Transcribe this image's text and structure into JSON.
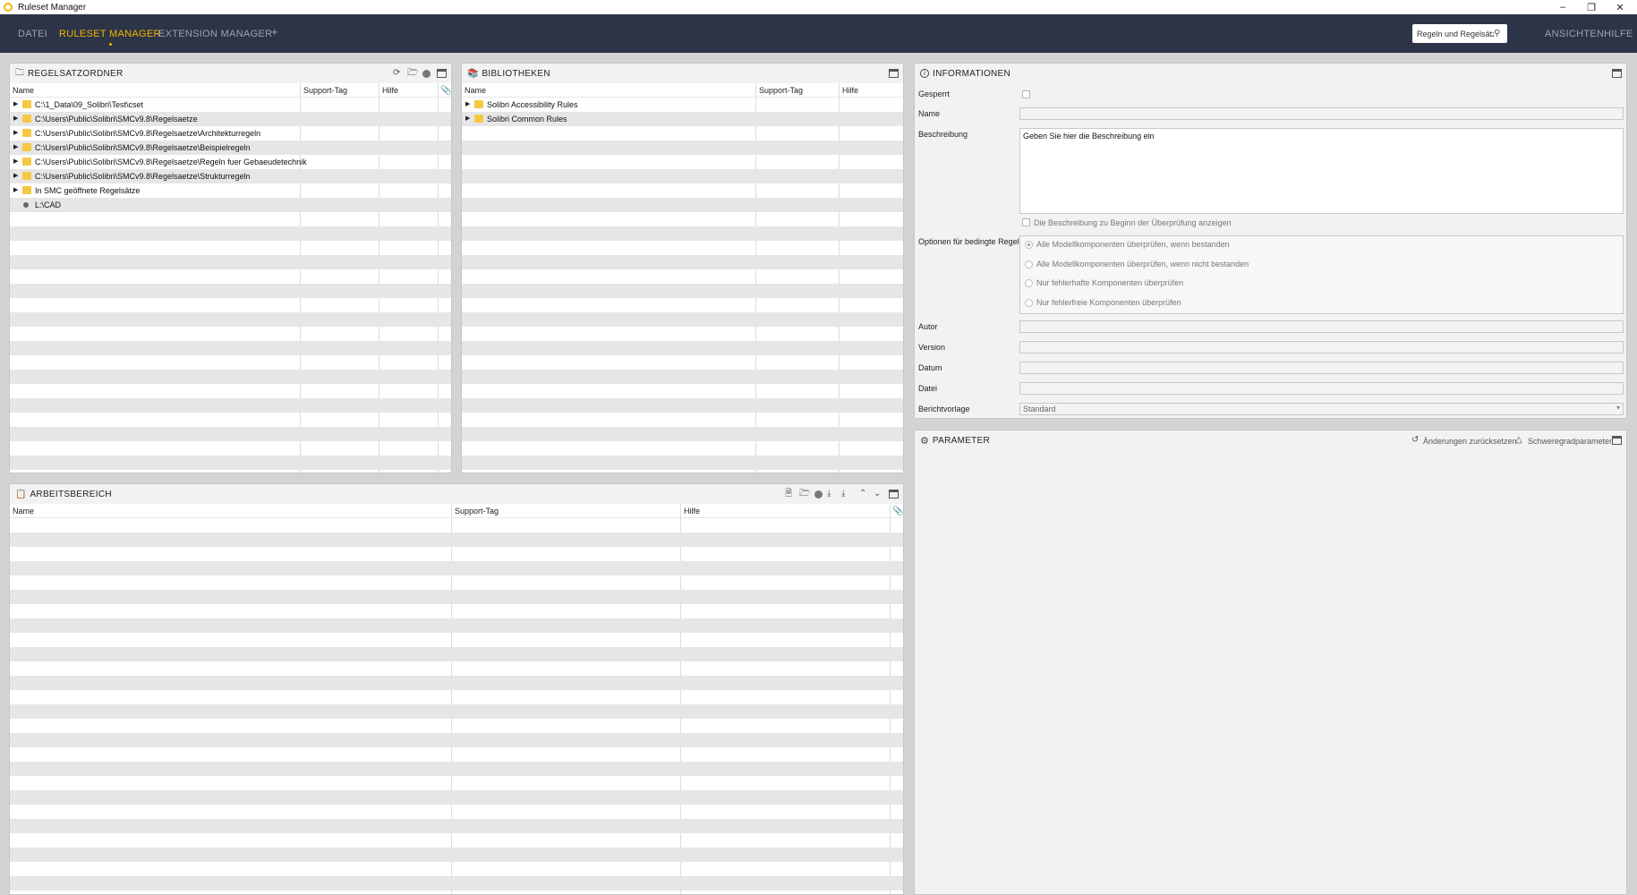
{
  "window": {
    "title": "Ruleset Manager",
    "minimize": "–",
    "restore": "❐",
    "close": "✕"
  },
  "menu": {
    "items": [
      "DATEI",
      "RULESET MANAGER",
      "EXTENSION MANAGER",
      "+"
    ],
    "right_items": [
      "ANSICHTEN",
      "HILFE"
    ],
    "search_placeholder": "Regeln und Regelsätze suchen"
  },
  "regelsatzordner": {
    "title": "REGELSATZORDNER",
    "columns": [
      "Name",
      "Support-Tag",
      "Hilfe"
    ],
    "rows": [
      {
        "label": "C:\\1_Data\\09_Solibri\\Test\\cset",
        "kind": "folder"
      },
      {
        "label": "C:\\Users\\Public\\Solibri\\SMCv9.8\\Regelsaetze",
        "kind": "folder"
      },
      {
        "label": "C:\\Users\\Public\\Solibri\\SMCv9.8\\Regelsaetze\\Architekturregeln",
        "kind": "folder"
      },
      {
        "label": "C:\\Users\\Public\\Solibri\\SMCv9.8\\Regelsaetze\\Beispielregeln",
        "kind": "folder"
      },
      {
        "label": "C:\\Users\\Public\\Solibri\\SMCv9.8\\Regelsaetze\\Regeln fuer Gebaeudetechnik",
        "kind": "folder"
      },
      {
        "label": "C:\\Users\\Public\\Solibri\\SMCv9.8\\Regelsaetze\\Strukturregeln",
        "kind": "folder"
      },
      {
        "label": "In SMC geöffnete Regelsätze",
        "kind": "folder"
      },
      {
        "label": "L:\\CAD",
        "kind": "drive"
      }
    ]
  },
  "bibliotheken": {
    "title": "BIBLIOTHEKEN",
    "columns": [
      "Name",
      "Support-Tag",
      "Hilfe"
    ],
    "rows": [
      {
        "label": "Solibri Accessibility Rules",
        "kind": "folder"
      },
      {
        "label": "Solibri Common Rules",
        "kind": "folder"
      }
    ]
  },
  "arbeitsbereich": {
    "title": "ARBEITSBEREICH",
    "columns": [
      "Name",
      "Support-Tag",
      "Hilfe"
    ]
  },
  "informationen": {
    "title": "INFORMATIONEN",
    "labels": {
      "gesperrt": "Gesperrt",
      "name": "Name",
      "beschreibung": "Beschreibung",
      "optionen": "Optionen für bedingte Regel",
      "autor": "Autor",
      "version": "Version",
      "datum": "Datum",
      "datei": "Datei",
      "berichtvorlage": "Berichtvorlage"
    },
    "beschreibung_value": "Geben Sie hier die Beschreibung ein",
    "show_description_label": "Die Beschreibung zu Beginn der Überprüfung anzeigen",
    "options": [
      "Alle Modellkomponenten überprüfen, wenn bestanden",
      "Alle Modellkomponenten überprüfen, wenn nicht bestanden",
      "Nur fehlerhafte Komponenten überprüfen",
      "Nur fehlerfreie Komponenten überprüfen"
    ],
    "berichtvorlage_value": "Standard"
  },
  "parameter": {
    "title": "PARAMETER",
    "reset_label": "Änderungen zurücksetzen",
    "severity_label": "Schweregradparameter"
  }
}
